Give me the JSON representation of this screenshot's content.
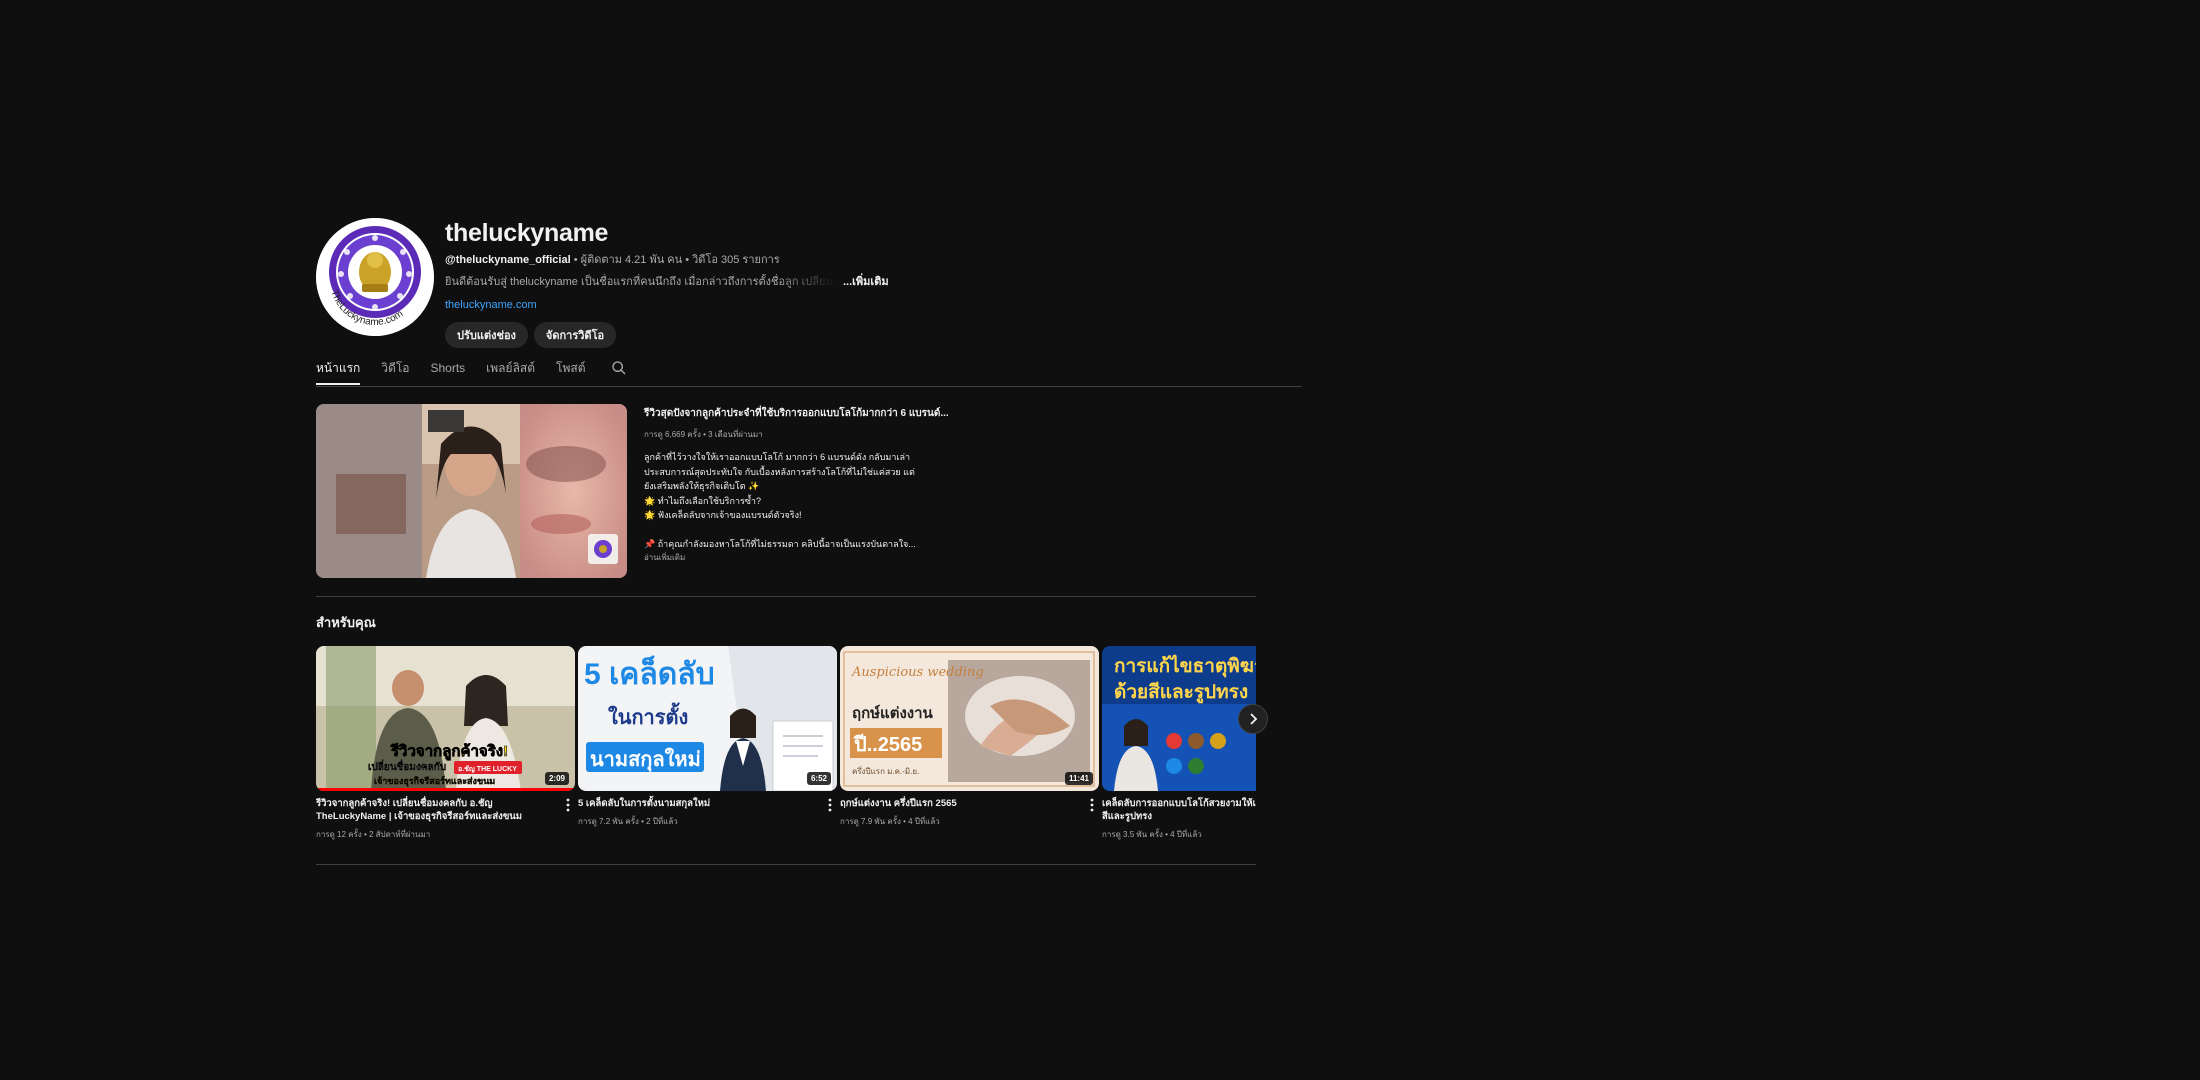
{
  "channel": {
    "name": "theluckyname",
    "handle": "@theluckyname_official",
    "stats": " • ผู้ติดตาม 4.21 พัน คน • วิดีโอ 305 รายการ",
    "description": "ยินดีต้อนรับสู่ theluckyname เป็นชื่อแรกที่คนนึกถึง เมื่อกล่าวถึงการตั้งชื่อลูก เปลี่ยนชื่อ / ...",
    "more_label": "...เพิ่มเติม",
    "link": "theluckyname.com",
    "avatar_text": "TheLuckyname.com",
    "buttons": {
      "customize": "ปรับแต่งช่อง",
      "manage_videos": "จัดการวิดีโอ"
    }
  },
  "tabs": [
    {
      "label": "หน้าแรก",
      "active": true
    },
    {
      "label": "วิดีโอ"
    },
    {
      "label": "Shorts"
    },
    {
      "label": "เพลย์ลิสต์"
    },
    {
      "label": "โพสต์"
    }
  ],
  "featured": {
    "title": "รีวิวสุดปังจากลูกค้าประจำที่ใช้บริการออกแบบโลโก้มากกว่า 6 แบรนด์...",
    "meta": "การดู 6,669 ครั้ง • 3 เดือนที่ผ่านมา",
    "description": "ลูกค้าที่ไว้วางใจให้เราออกแบบโลโก้ มากกว่า 6 แบรนด์ดัง กลับมาเล่า\nประสบการณ์สุดประทับใจ กับเบื้องหลังการสร้างโลโก้ที่ไม่ใช่แค่สวย แต่\nยังเสริมพลังให้ธุรกิจเติบโต ✨\n🌟 ทำไมถึงเลือกใช้บริการซ้ำ?\n🌟 ฟังเคล็ดลับจากเจ้าของแบรนด์ตัวจริง!\n\n📌 ถ้าคุณกำลังมองหาโลโก้ที่ไม่ธรรมดา คลิปนี้อาจเป็นแรงบันดาลใจ...",
    "read_more": "อ่านเพิ่มเติม"
  },
  "shelf": {
    "title": "สำหรับคุณ",
    "videos": [
      {
        "title": "รีวิวจากลูกค้าจริง! เปลี่ยนชื่อมงคลกับ อ.ชัญ TheLuckyName | เจ้าของธุรกิจรีสอร์ทและส่งขนม",
        "meta": "การดู 12 ครั้ง • 2 สัปดาห์ที่ผ่านมา",
        "duration": "2:09",
        "progress": 1.0,
        "thumb_main": "รีวิวจากลูกค้าจริง!",
        "thumb_sub": "เปลี่ยนชื่อมงคลกับ",
        "thumb_tag": "อ.ชัญ THE LUCKY",
        "thumb_line3": "เจ้าของธุรกิจรีสอร์ทและส่งขนม"
      },
      {
        "title": "5 เคล็ดลับในการตั้งนามสกุลใหม่",
        "meta": "การดู 7.2 พัน ครั้ง • 2 ปีที่แล้ว",
        "duration": "6:52",
        "progress": 0,
        "thumb_main": "5 เคล็ดลับ",
        "thumb_sub": "ในการตั้ง",
        "thumb_tag": "นามสกุลใหม่"
      },
      {
        "title": "ฤกษ์แต่งงาน ครึ่งปีแรก 2565",
        "meta": "การดู 7.9 พัน ครั้ง • 4 ปีที่แล้ว",
        "duration": "11:41",
        "progress": 0,
        "thumb_script": "Auspicious wedding",
        "thumb_main": "ฤกษ์แต่งงาน",
        "thumb_sub": "ปี..2565",
        "thumb_tag": "ครึ่งปีแรก ม.ค.-มิ.ย."
      },
      {
        "title": "เคล็ดลับการออกแบบโลโก้สวยงามให้เหมาะกับ พิฆาต ด้วยสีและรูปทรง",
        "meta": "การดู 3.5 พัน ครั้ง • 4 ปีที่แล้ว",
        "duration": "",
        "progress": 0,
        "thumb_main": "การแก้ไขธาตุพิฆาต",
        "thumb_sub": "ด้วยสีและรูปทรง"
      }
    ]
  },
  "colors": {
    "background": "#0f0f0f",
    "link": "#3ea6ff",
    "progress": "#ff0000",
    "muted_text": "#aaaaaa"
  }
}
